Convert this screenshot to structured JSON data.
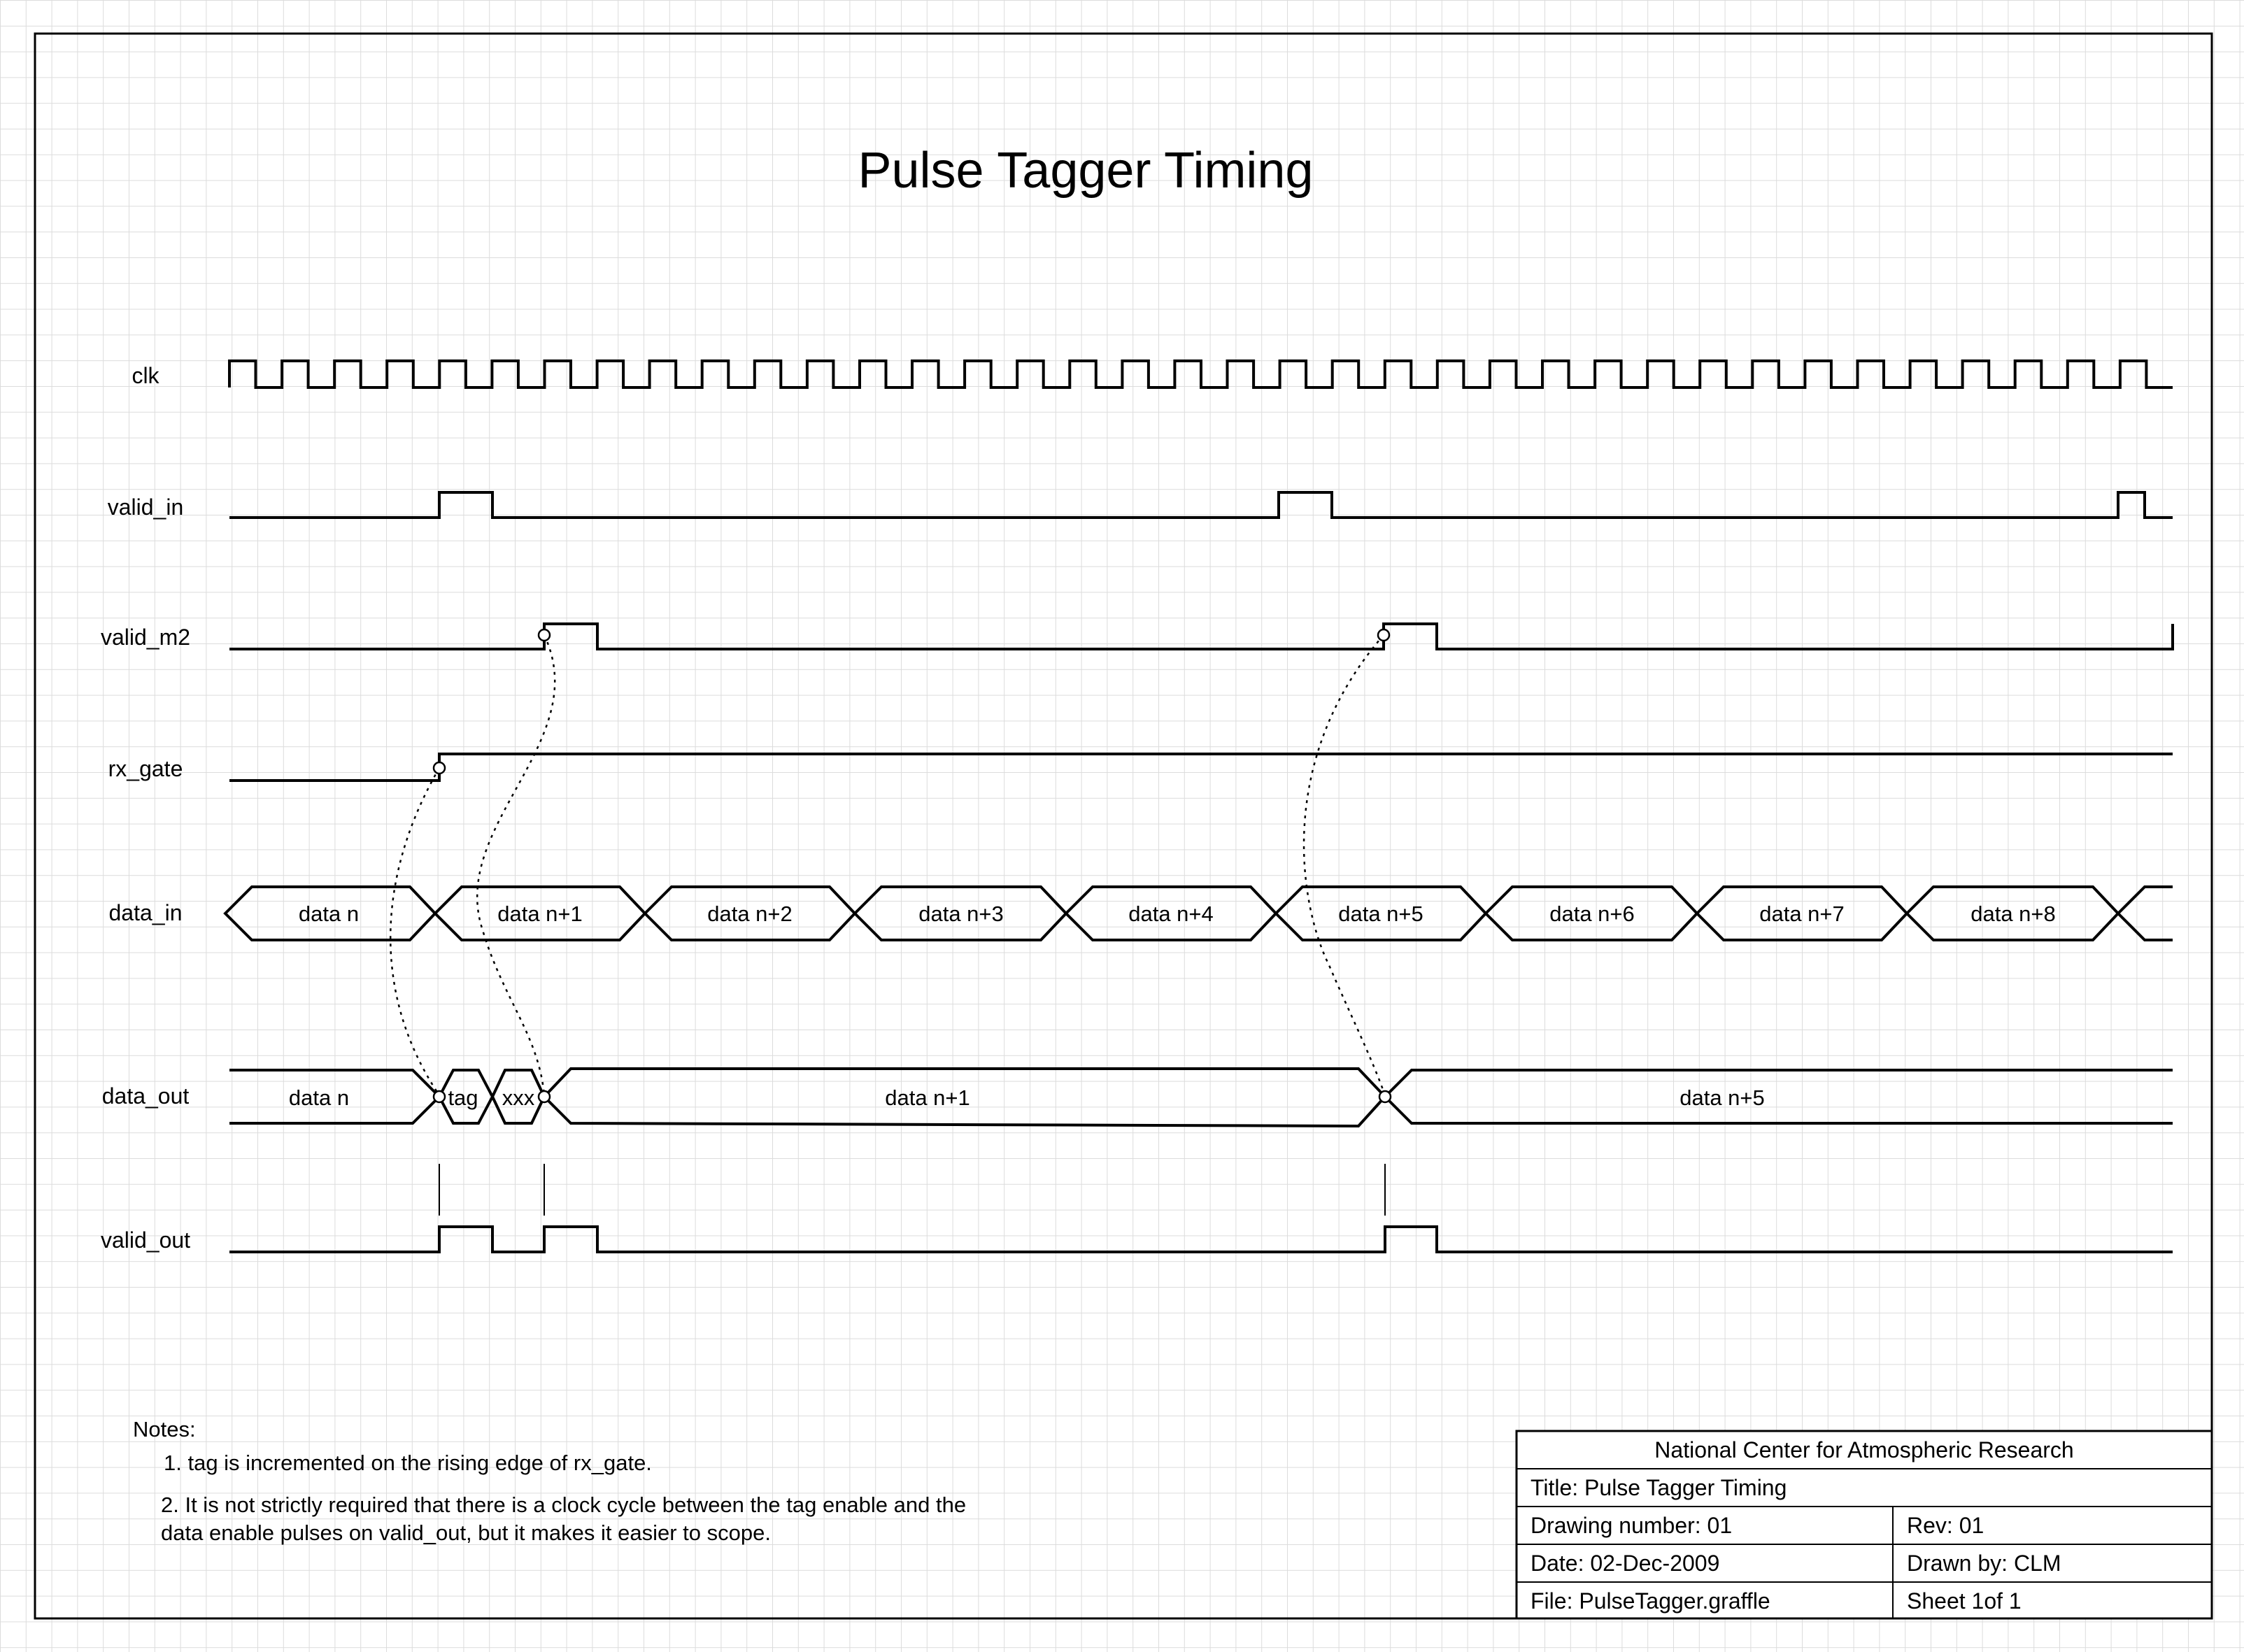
{
  "title": "Pulse Tagger Timing",
  "signals": {
    "clk": "clk",
    "valid_in": "valid_in",
    "valid_m2": "valid_m2",
    "rx_gate": "rx_gate",
    "data_in": "data_in",
    "data_out": "data_out",
    "valid_out": "valid_out"
  },
  "data_in_cells": [
    "data n",
    "data n+1",
    "data n+2",
    "data n+3",
    "data n+4",
    "data n+5",
    "data n+6",
    "data n+7",
    "data n+8"
  ],
  "data_out_cells": [
    "data n",
    "tag",
    "xxx",
    "data n+1",
    "data n+5"
  ],
  "notes": {
    "heading": "Notes:",
    "note1": "1. tag is incremented on the rising edge of rx_gate.",
    "note2_line1": "2. It is not strictly required that there is a clock cycle between  the tag enable and the",
    "note2_line2": "data enable pulses on valid_out, but it makes it easier to scope."
  },
  "title_block": {
    "org": "National Center for Atmospheric Research",
    "title": "Title: Pulse Tagger Timing",
    "drawing_number": "Drawing number: 01",
    "rev": "Rev: 01",
    "date": "Date: 02-Dec-2009",
    "drawn_by": "Drawn by: CLM",
    "file": "File: PulseTagger.graffle",
    "sheet": "Sheet 1of 1"
  }
}
